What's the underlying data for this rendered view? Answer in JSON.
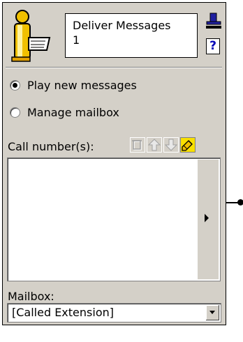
{
  "header": {
    "title_line1": "Deliver Messages",
    "title_line2": "1",
    "help_label": "?"
  },
  "options": {
    "play_new_messages": "Play new messages",
    "manage_mailbox": "Manage mailbox",
    "selected": "play_new_messages"
  },
  "call_numbers": {
    "label": "Call number(s):",
    "items": []
  },
  "mailbox": {
    "label": "Mailbox:",
    "value": "[Called Extension]"
  },
  "colors": {
    "panel_bg": "#d4d0c8",
    "accent_yellow": "#f0c000",
    "help_blue": "#0000b8"
  }
}
